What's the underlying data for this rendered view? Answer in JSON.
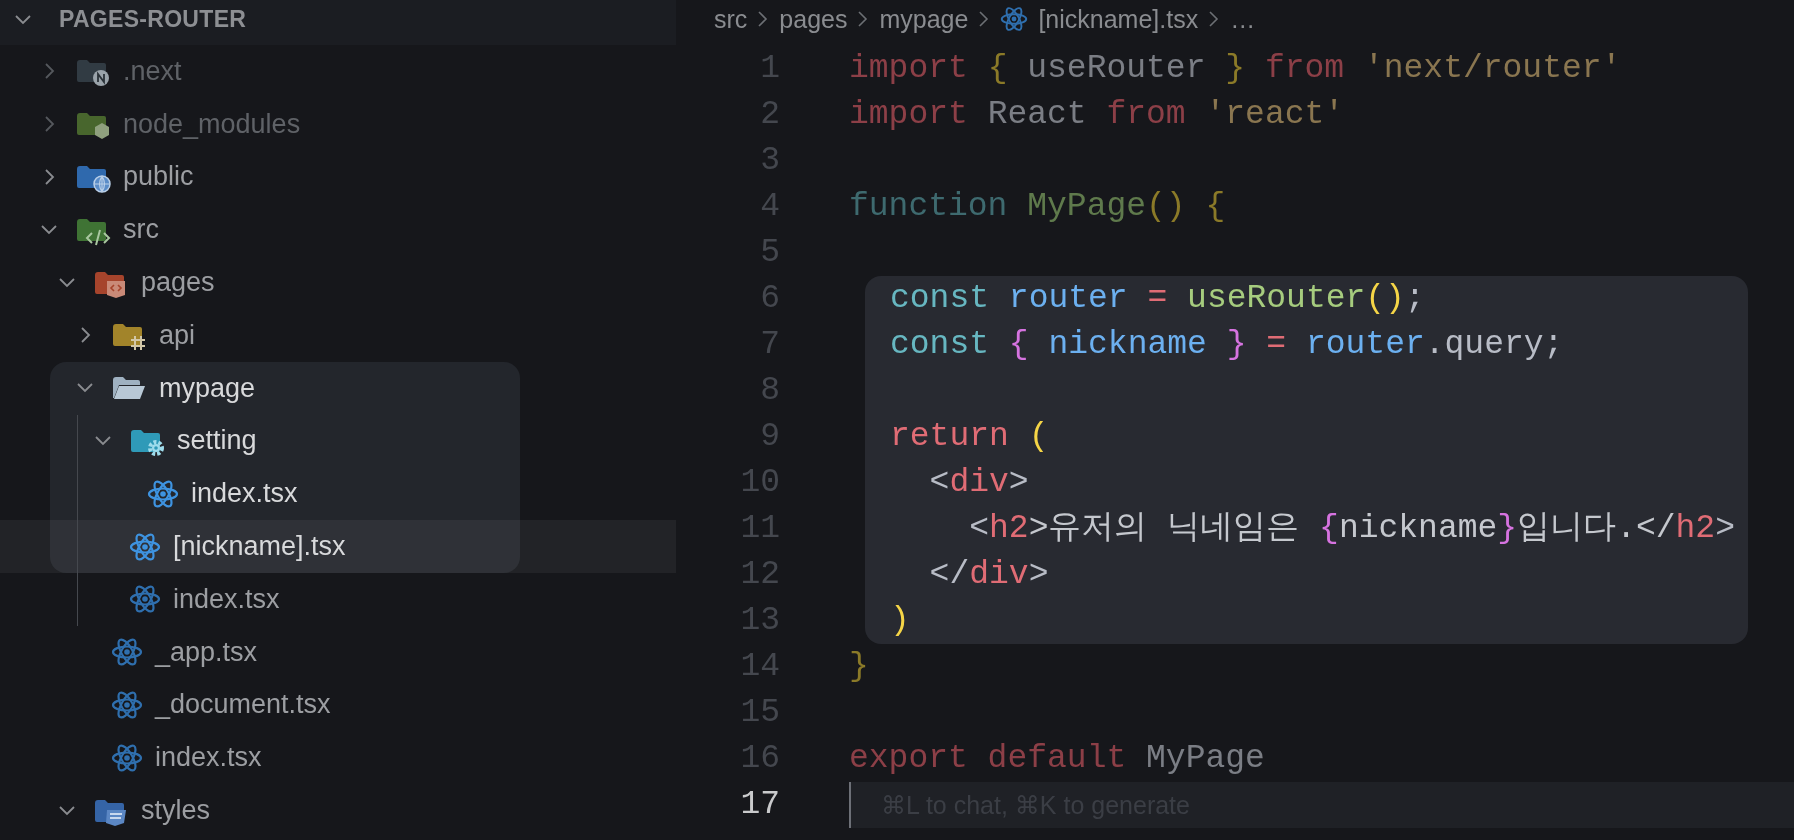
{
  "explorer": {
    "title": "PAGES-ROUTER",
    "expanded": true,
    "tree": [
      {
        "name": ".next",
        "kind": "next",
        "expanded": false,
        "dimmed": true,
        "focused": false,
        "selected": false
      },
      {
        "name": "node_modules",
        "kind": "modules",
        "expanded": false,
        "dimmed": true,
        "focused": false,
        "selected": false
      },
      {
        "name": "public",
        "kind": "public",
        "expanded": false,
        "dimmed": false,
        "focused": false,
        "selected": false
      },
      {
        "name": "src",
        "kind": "source",
        "expanded": true,
        "dimmed": false,
        "focused": false,
        "selected": false,
        "children": [
          {
            "name": "pages",
            "kind": "pages",
            "expanded": true,
            "dimmed": false,
            "focused": false,
            "selected": false,
            "children": [
              {
                "name": "api",
                "kind": "api",
                "expanded": false,
                "dimmed": false,
                "focused": false,
                "selected": false
              },
              {
                "name": "mypage",
                "kind": "plain",
                "expanded": true,
                "dimmed": false,
                "focused": true,
                "selected": false,
                "children": [
                  {
                    "name": "setting",
                    "kind": "settings",
                    "expanded": true,
                    "dimmed": false,
                    "focused": true,
                    "selected": false,
                    "children": [
                      {
                        "name": "index.tsx",
                        "kind": "react",
                        "dimmed": false,
                        "focused": true,
                        "selected": false
                      }
                    ]
                  },
                  {
                    "name": "[nickname].tsx",
                    "kind": "react",
                    "dimmed": false,
                    "focused": true,
                    "selected": true
                  },
                  {
                    "name": "index.tsx",
                    "kind": "react",
                    "dimmed": false,
                    "focused": false,
                    "selected": false
                  }
                ]
              },
              {
                "name": "_app.tsx",
                "kind": "react",
                "dimmed": false,
                "focused": false,
                "selected": false
              },
              {
                "name": "_document.tsx",
                "kind": "react",
                "dimmed": false,
                "focused": false,
                "selected": false
              },
              {
                "name": "index.tsx",
                "kind": "react",
                "dimmed": false,
                "focused": false,
                "selected": false
              }
            ]
          },
          {
            "name": "styles",
            "kind": "styles",
            "expanded": true,
            "dimmed": false,
            "focused": false,
            "selected": false
          }
        ]
      }
    ]
  },
  "editor": {
    "breadcrumb": [
      {
        "label": "src",
        "kind": "folder"
      },
      {
        "label": "pages",
        "kind": "folder"
      },
      {
        "label": "mypage",
        "kind": "folder"
      },
      {
        "label": "[nickname].tsx",
        "kind": "file"
      },
      {
        "label": "…",
        "kind": "more"
      }
    ],
    "lines": [
      {
        "number": "1",
        "focused": false,
        "current": false,
        "tokens": [
          {
            "text": "import ",
            "kind": "keyword"
          },
          {
            "text": "{",
            "kind": "bracket"
          },
          {
            "text": " useRouter ",
            "kind": "variable"
          },
          {
            "text": "}",
            "kind": "bracket"
          },
          {
            "text": " from ",
            "kind": "keyword"
          },
          {
            "text": "'next/router'",
            "kind": "string"
          }
        ]
      },
      {
        "number": "2",
        "focused": false,
        "current": false,
        "tokens": [
          {
            "text": "import ",
            "kind": "keyword"
          },
          {
            "text": "React",
            "kind": "variable"
          },
          {
            "text": " from ",
            "kind": "keyword"
          },
          {
            "text": "'react'",
            "kind": "string"
          }
        ]
      },
      {
        "number": "3",
        "focused": false,
        "current": false
      },
      {
        "number": "4",
        "focused": false,
        "current": false,
        "tokens": [
          {
            "text": "function ",
            "kind": "storage"
          },
          {
            "text": "MyPage",
            "kind": "function"
          },
          {
            "text": "()",
            "kind": "paren"
          },
          {
            "text": " {",
            "kind": "bracket"
          }
        ]
      },
      {
        "number": "5",
        "focused": false,
        "current": false
      },
      {
        "number": "6",
        "focused": true,
        "current": false,
        "tokens": [
          {
            "text": "const ",
            "kind": "storage"
          },
          {
            "text": "router",
            "kind": "variable"
          },
          {
            "text": " = ",
            "kind": "operator"
          },
          {
            "text": "useRouter",
            "kind": "function"
          },
          {
            "text": "()",
            "kind": "paren"
          },
          {
            "text": ";",
            "kind": "punct"
          }
        ]
      },
      {
        "number": "7",
        "focused": true,
        "current": false,
        "tokens": [
          {
            "text": "const ",
            "kind": "storage"
          },
          {
            "text": "{",
            "kind": "brace"
          },
          {
            "text": " nickname ",
            "kind": "variable"
          },
          {
            "text": "}",
            "kind": "brace"
          },
          {
            "text": " = ",
            "kind": "operator"
          },
          {
            "text": "router",
            "kind": "variable"
          },
          {
            "text": ".query;",
            "kind": "punct"
          }
        ]
      },
      {
        "number": "8",
        "focused": true,
        "current": false
      },
      {
        "number": "9",
        "focused": true,
        "current": false,
        "tokens": [
          {
            "text": "return ",
            "kind": "keyword"
          },
          {
            "text": "(",
            "kind": "paren"
          }
        ]
      },
      {
        "number": "10",
        "focused": true,
        "current": false,
        "tokens": [
          {
            "text": "  <",
            "kind": "punct"
          },
          {
            "text": "div",
            "kind": "tag"
          },
          {
            "text": ">",
            "kind": "punct"
          }
        ]
      },
      {
        "number": "11",
        "focused": true,
        "current": false,
        "tokens": [
          {
            "text": "    <",
            "kind": "punct"
          },
          {
            "text": "h2",
            "kind": "tag"
          },
          {
            "text": ">유저의 닉네임은 ",
            "kind": "text"
          },
          {
            "text": "{",
            "kind": "brace"
          },
          {
            "text": "nickname",
            "kind": "text"
          },
          {
            "text": "}",
            "kind": "brace"
          },
          {
            "text": "입니다.</",
            "kind": "text"
          },
          {
            "text": "h2",
            "kind": "tag"
          },
          {
            "text": ">",
            "kind": "punct"
          }
        ]
      },
      {
        "number": "12",
        "focused": true,
        "current": false,
        "tokens": [
          {
            "text": "  </",
            "kind": "punct"
          },
          {
            "text": "div",
            "kind": "tag"
          },
          {
            "text": ">",
            "kind": "punct"
          }
        ]
      },
      {
        "number": "13",
        "focused": true,
        "current": false,
        "tokens": [
          {
            "text": ")",
            "kind": "paren"
          }
        ]
      },
      {
        "number": "14",
        "focused": false,
        "current": false,
        "tokens": [
          {
            "text": "}",
            "kind": "bracket"
          }
        ]
      },
      {
        "number": "15",
        "focused": false,
        "current": false
      },
      {
        "number": "16",
        "focused": false,
        "current": false,
        "tokens": [
          {
            "text": "export default ",
            "kind": "keyword"
          },
          {
            "text": "MyPage",
            "kind": "variable"
          }
        ]
      },
      {
        "number": "17",
        "focused": false,
        "current": true,
        "hint": "⌘L to chat, ⌘K to generate"
      }
    ]
  }
}
